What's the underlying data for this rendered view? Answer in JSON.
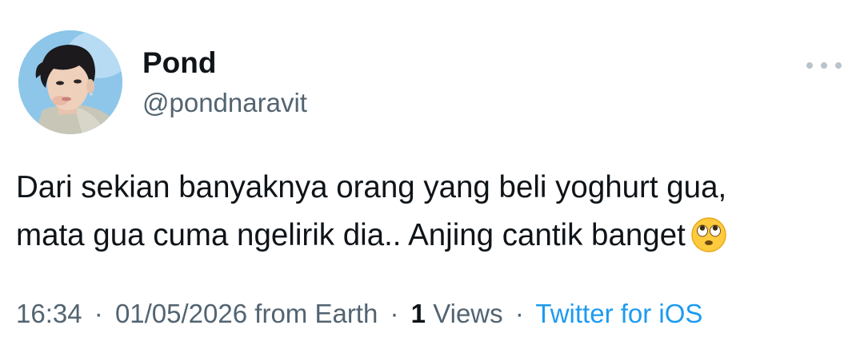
{
  "author": {
    "display_name": "Pond",
    "handle": "@pondnaravit",
    "avatar_icon": "profile-photo"
  },
  "tweet": {
    "text_line_1": "Dari sekian banyaknya orang yang beli yoghurt gua,",
    "text_line_2": "mata gua cuma ngelirik dia.. Anjing cantik banget",
    "emoji": "face-with-rolling-eyes-icon"
  },
  "meta": {
    "time": "16:34",
    "separator": "·",
    "date": "01/05/2026",
    "location": "from Earth",
    "views_count": "1",
    "views_label": "Views",
    "source": "Twitter for iOS"
  },
  "colors": {
    "text_primary": "#0f1419",
    "text_secondary": "#536471",
    "link": "#1d9bf0",
    "more_dots": "#b9c3cb"
  }
}
